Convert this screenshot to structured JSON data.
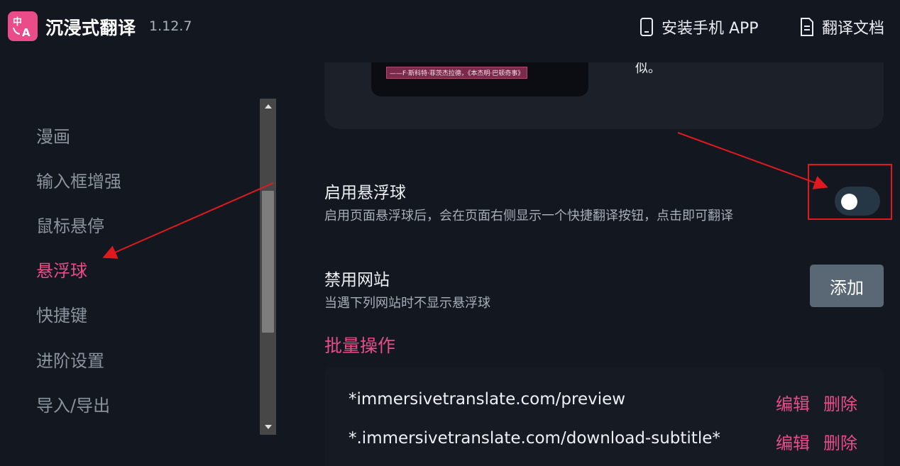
{
  "header": {
    "app_title": "沉浸式翻译",
    "version": "1.12.7",
    "install_app": "安装手机 APP",
    "docs": "翻译文档"
  },
  "sidebar": {
    "items": [
      {
        "label": "漫画",
        "active": false
      },
      {
        "label": "输入框增强",
        "active": false
      },
      {
        "label": "鼠标悬停",
        "active": false
      },
      {
        "label": "悬浮球",
        "active": true
      },
      {
        "label": "快捷键",
        "active": false
      },
      {
        "label": "进阶设置",
        "active": false
      },
      {
        "label": "导入/导出",
        "active": false
      }
    ]
  },
  "preview": {
    "quote": "——F·斯科特·菲茨杰拉德，《本杰明·巴顿奇事》",
    "trailing_text": "似。"
  },
  "floating_ball": {
    "title": "启用悬浮球",
    "description": "启用页面悬浮球后，会在页面右侧显示一个快捷翻译按钮，点击即可翻译",
    "enabled": false
  },
  "blocked_sites": {
    "title": "禁用网站",
    "description": "当遇下列网站时不显示悬浮球",
    "add_label": "添加"
  },
  "batch": {
    "title": "批量操作",
    "sites": [
      {
        "url": "*immersivetranslate.com/preview",
        "edit": "编辑",
        "delete": "删除"
      },
      {
        "url": "*.immersivetranslate.com/download-subtitle*",
        "edit": "编辑",
        "delete": "删除"
      }
    ]
  },
  "colors": {
    "accent": "#ea4c89",
    "background": "#13171f",
    "annotation": "#e0191e"
  }
}
